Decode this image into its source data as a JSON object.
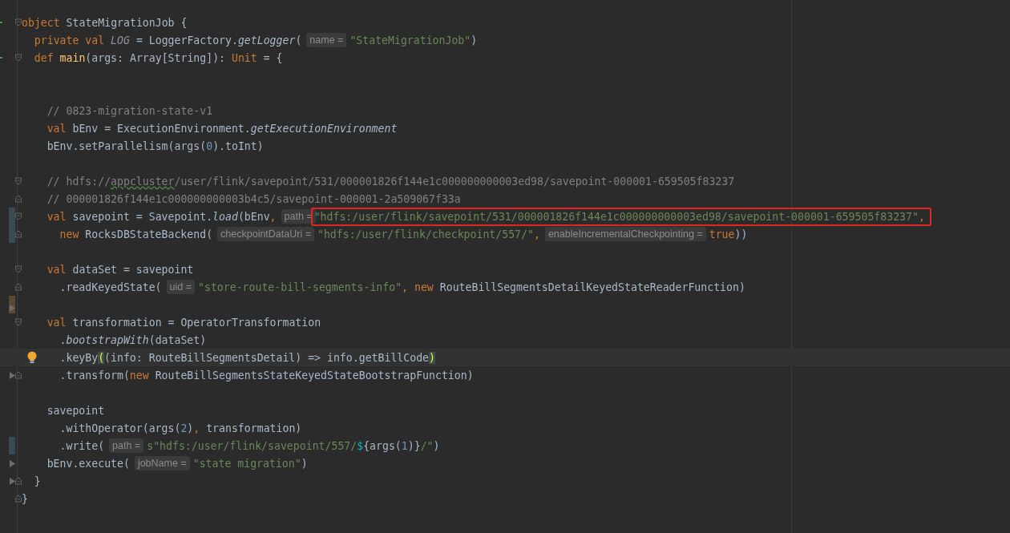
{
  "editor": {
    "lines": [
      {
        "kind": "code",
        "fold_open": true,
        "run_marker": true,
        "segments": [
          {
            "kind": "code",
            "tokens": [
              {
                "kind": "keyword",
                "text": "object"
              },
              {
                "kind": "plain",
                "text": " StateMigrationJob {"
              }
            ]
          }
        ],
        "children": [
          {
            "kind": "code",
            "segments": [
              {
                "kind": "code",
                "tokens": [
                  {
                    "kind": "keyword",
                    "text": "private val "
                  },
                  {
                    "kind": "constant",
                    "text": "LOG"
                  },
                  {
                    "kind": "plain",
                    "text": " = LoggerFactory."
                  },
                  {
                    "kind": "italic",
                    "text": "getLogger"
                  },
                  {
                    "kind": "plain",
                    "text": "("
                  }
                ]
              },
              {
                "kind": "hint",
                "text": "name ="
              },
              {
                "kind": "code",
                "tokens": [
                  {
                    "kind": "string",
                    "text": "\"StateMigrationJob\""
                  },
                  {
                    "kind": "plain",
                    "text": ")"
                  }
                ]
              }
            ]
          },
          {
            "kind": "code",
            "fold_open": true,
            "run_marker": true,
            "segments": [
              {
                "kind": "code",
                "tokens": [
                  {
                    "kind": "keyword",
                    "text": "def "
                  },
                  {
                    "kind": "function",
                    "text": "main"
                  },
                  {
                    "kind": "plain",
                    "text": "(args: Array[String]): "
                  },
                  {
                    "kind": "keyword",
                    "text": "Unit"
                  },
                  {
                    "kind": "plain",
                    "text": " = {"
                  }
                ]
              }
            ],
            "children": [
              {
                "kind": "blank"
              },
              {
                "kind": "blank"
              },
              {
                "kind": "code",
                "segments": [
                  {
                    "kind": "code",
                    "tokens": [
                      {
                        "kind": "comment",
                        "text": "// 0823-migration-state-v1"
                      }
                    ]
                  }
                ]
              },
              {
                "kind": "code",
                "segments": [
                  {
                    "kind": "code",
                    "tokens": [
                      {
                        "kind": "keyword",
                        "text": "val "
                      },
                      {
                        "kind": "plain",
                        "text": "bEnv = ExecutionEnvironment."
                      },
                      {
                        "kind": "italic",
                        "text": "getExecutionEnvironment"
                      }
                    ]
                  }
                ]
              },
              {
                "kind": "code",
                "segments": [
                  {
                    "kind": "code",
                    "tokens": [
                      {
                        "kind": "plain",
                        "text": "bEnv.setParallelism(args("
                      },
                      {
                        "kind": "number",
                        "text": "0"
                      },
                      {
                        "kind": "plain",
                        "text": ").toInt)"
                      }
                    ]
                  }
                ]
              },
              {
                "kind": "blank"
              },
              {
                "kind": "code",
                "fold_open": true,
                "segments": [
                  {
                    "kind": "code",
                    "tokens": [
                      {
                        "kind": "comment",
                        "text": "// hdfs://"
                      },
                      {
                        "kind": "typo",
                        "text": "appcluster"
                      },
                      {
                        "kind": "comment",
                        "text": "/user/flink/savepoint/531/000001826f144e1c000000000003ed98/savepoint-000001-659505f83237"
                      }
                    ]
                  }
                ]
              },
              {
                "kind": "code",
                "fold_close": true,
                "segments": [
                  {
                    "kind": "code",
                    "tokens": [
                      {
                        "kind": "comment",
                        "text": "// 000001826f144e1c000000000003b4c5/savepoint-000001-2a509067f33a"
                      }
                    ]
                  }
                ]
              },
              {
                "kind": "code",
                "fold_open": true,
                "color": "#3a4a55",
                "segments": [
                  {
                    "kind": "code",
                    "tokens": [
                      {
                        "kind": "keyword",
                        "text": "val "
                      },
                      {
                        "kind": "plain",
                        "text": "savepoint = Savepoint."
                      },
                      {
                        "kind": "italic",
                        "text": "load"
                      },
                      {
                        "kind": "plain",
                        "text": "(bEnv"
                      },
                      {
                        "kind": "keyword",
                        "text": ","
                      }
                    ]
                  },
                  {
                    "kind": "hint",
                    "text": "path ="
                  },
                  {
                    "kind": "box",
                    "segments": [
                      {
                        "kind": "code",
                        "tokens": [
                          {
                            "kind": "string",
                            "text": "\"hdfs:/user/flink/savepoint/531/000001826f144e1c000000000003ed98/savepoint-000001-659505f83237\""
                          },
                          {
                            "kind": "keyword",
                            "text": ","
                          }
                        ]
                      }
                    ]
                  }
                ],
                "children": [
                  {
                    "kind": "code",
                    "fold_close": true,
                    "color": "#3a4a55",
                    "segments": [
                      {
                        "kind": "code",
                        "tokens": [
                          {
                            "kind": "keyword",
                            "text": "new "
                          },
                          {
                            "kind": "plain",
                            "text": "RocksDBStateBackend("
                          }
                        ]
                      },
                      {
                        "kind": "hint",
                        "text": "checkpointDataUri ="
                      },
                      {
                        "kind": "code",
                        "tokens": [
                          {
                            "kind": "string",
                            "text": "\"hdfs:/user/flink/checkpoint/557/\""
                          },
                          {
                            "kind": "keyword",
                            "text": ","
                          }
                        ]
                      },
                      {
                        "kind": "hint",
                        "text": "enableIncrementalCheckpointing ="
                      },
                      {
                        "kind": "code",
                        "tokens": [
                          {
                            "kind": "keyword",
                            "text": "true"
                          },
                          {
                            "kind": "plain",
                            "text": "))"
                          }
                        ]
                      }
                    ]
                  }
                ]
              },
              {
                "kind": "blank"
              },
              {
                "kind": "code",
                "fold_open": true,
                "segments": [
                  {
                    "kind": "code",
                    "tokens": [
                      {
                        "kind": "keyword",
                        "text": "val "
                      },
                      {
                        "kind": "plain",
                        "text": "dataSet = savepoint"
                      }
                    ]
                  }
                ],
                "children": [
                  {
                    "kind": "code",
                    "fold_close": true,
                    "segments": [
                      {
                        "kind": "code",
                        "tokens": [
                          {
                            "kind": "plain",
                            "text": ".readKeyedState("
                          }
                        ]
                      },
                      {
                        "kind": "hint",
                        "text": "uid ="
                      },
                      {
                        "kind": "code",
                        "tokens": [
                          {
                            "kind": "string",
                            "text": "\"store-route-bill-segments-info\""
                          },
                          {
                            "kind": "keyword",
                            "text": ", new "
                          },
                          {
                            "kind": "plain",
                            "text": "RouteBillSegmentsDetailKeyedStateReaderFunction)"
                          }
                        ]
                      }
                    ]
                  }
                ]
              },
              {
                "kind": "blank",
                "color": "#5a4a33",
                "arrow": true
              },
              {
                "kind": "code",
                "fold_open": true,
                "segments": [
                  {
                    "kind": "code",
                    "tokens": [
                      {
                        "kind": "keyword",
                        "text": "val "
                      },
                      {
                        "kind": "plain",
                        "text": "transformation = OperatorTransformation"
                      }
                    ]
                  }
                ],
                "children": [
                  {
                    "kind": "code",
                    "segments": [
                      {
                        "kind": "code",
                        "tokens": [
                          {
                            "kind": "plain",
                            "text": "."
                          },
                          {
                            "kind": "italic",
                            "text": "bootstrapWith"
                          },
                          {
                            "kind": "plain",
                            "text": "(dataSet)"
                          }
                        ]
                      }
                    ]
                  },
                  {
                    "kind": "code",
                    "current": true,
                    "bulb": true,
                    "segments": [
                      {
                        "kind": "code",
                        "tokens": [
                          {
                            "kind": "plain",
                            "text": ".keyBy"
                          },
                          {
                            "kind": "brace-match",
                            "text": "("
                          },
                          {
                            "kind": "plain",
                            "text": "(info: RouteBillSegmentsDetail) => info.getBillCode"
                          },
                          {
                            "kind": "brace-match",
                            "text": ")"
                          }
                        ]
                      }
                    ]
                  },
                  {
                    "kind": "code",
                    "fold_close": true,
                    "arrow": true,
                    "segments": [
                      {
                        "kind": "code",
                        "tokens": [
                          {
                            "kind": "plain",
                            "text": ".transform("
                          },
                          {
                            "kind": "keyword",
                            "text": "new"
                          },
                          {
                            "kind": "plain",
                            "text": " RouteBillSegmentsStateKeyedStateBootstrapFunction)"
                          }
                        ]
                      }
                    ]
                  }
                ]
              },
              {
                "kind": "blank"
              },
              {
                "kind": "code",
                "segments": [
                  {
                    "kind": "code",
                    "tokens": [
                      {
                        "kind": "plain",
                        "text": "savepoint"
                      }
                    ]
                  }
                ],
                "children": [
                  {
                    "kind": "code",
                    "segments": [
                      {
                        "kind": "code",
                        "tokens": [
                          {
                            "kind": "plain",
                            "text": ".withOperator(args("
                          },
                          {
                            "kind": "number",
                            "text": "2"
                          },
                          {
                            "kind": "plain",
                            "text": ")"
                          },
                          {
                            "kind": "keyword",
                            "text": ","
                          },
                          {
                            "kind": "plain",
                            "text": " transformation)"
                          }
                        ]
                      }
                    ]
                  },
                  {
                    "kind": "code",
                    "color": "#3a4a55",
                    "segments": [
                      {
                        "kind": "code",
                        "tokens": [
                          {
                            "kind": "plain",
                            "text": ".write("
                          }
                        ]
                      },
                      {
                        "kind": "hint",
                        "text": "path ="
                      },
                      {
                        "kind": "code",
                        "tokens": [
                          {
                            "kind": "string",
                            "text": "s\"hdfs:/user/flink/savepoint/557/"
                          },
                          {
                            "kind": "interpolation",
                            "text": "$"
                          },
                          {
                            "kind": "plain",
                            "text": "{args("
                          },
                          {
                            "kind": "number",
                            "text": "1"
                          },
                          {
                            "kind": "plain",
                            "text": ")}"
                          },
                          {
                            "kind": "string",
                            "text": "/\""
                          },
                          {
                            "kind": "plain",
                            "text": ")"
                          }
                        ]
                      }
                    ]
                  }
                ]
              },
              {
                "kind": "code",
                "arrow": true,
                "segments": [
                  {
                    "kind": "code",
                    "tokens": [
                      {
                        "kind": "plain",
                        "text": "bEnv.execute("
                      }
                    ]
                  },
                  {
                    "kind": "hint",
                    "text": "jobName ="
                  },
                  {
                    "kind": "code",
                    "tokens": [
                      {
                        "kind": "string",
                        "text": "\"state migration\""
                      },
                      {
                        "kind": "plain",
                        "text": ")"
                      }
                    ]
                  }
                ]
              }
            ]
          },
          {
            "kind": "code",
            "fold_close": true,
            "arrow": true,
            "segments": [
              {
                "kind": "code",
                "tokens": [
                  {
                    "kind": "plain",
                    "text": "}"
                  }
                ]
              }
            ]
          }
        ]
      },
      {
        "kind": "code",
        "fold_close": true,
        "segments": [
          {
            "kind": "code",
            "tokens": [
              {
                "kind": "plain",
                "text": "}"
              }
            ]
          }
        ]
      }
    ]
  }
}
